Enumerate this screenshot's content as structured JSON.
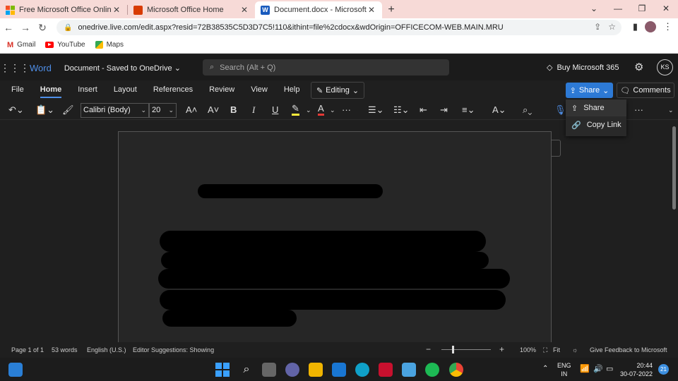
{
  "browser": {
    "tabs": [
      {
        "title": "Free Microsoft Office Online | W",
        "active": false
      },
      {
        "title": "Microsoft Office Home",
        "active": false
      },
      {
        "title": "Document.docx - Microsoft Wor",
        "active": true
      }
    ],
    "new_tab": "+",
    "url": "onedrive.live.com/edit.aspx?resid=72B38535C5D3D7C5!110&ithint=file%2cdocx&wdOrigin=OFFICECOM-WEB.MAIN.MRU",
    "bookmarks": [
      "Gmail",
      "YouTube",
      "Maps"
    ]
  },
  "word": {
    "app_name": "Word",
    "doc_title": "Document  -  Saved to OneDrive ⌄",
    "search_placeholder": "Search (Alt + Q)",
    "buy": "Buy Microsoft 365",
    "avatar": "KS",
    "ribbon_tabs": [
      "File",
      "Home",
      "Insert",
      "Layout",
      "References",
      "Review",
      "View",
      "Help"
    ],
    "active_tab": "Home",
    "editing": "Editing",
    "share": "Share",
    "comments": "Comments",
    "font": "Calibri (Body)",
    "font_size": "20",
    "share_menu": [
      "Share",
      "Copy Link"
    ]
  },
  "status": {
    "page": "Page 1 of 1",
    "words": "53 words",
    "language": "English (U.S.)",
    "editor": "Editor Suggestions: Showing",
    "zoom": "100%",
    "zoom_level": 1.0,
    "fit": "Fit",
    "feedback": "Give Feedback to Microsoft"
  },
  "taskbar": {
    "lang_line1": "ENG",
    "lang_line2": "IN",
    "time": "20:44",
    "date": "30-07-2022",
    "notifications": "21"
  },
  "colors": {
    "accent": "#2d7ad6",
    "word_blue": "#4f8fe8",
    "tabbar": "#f7dad7"
  }
}
